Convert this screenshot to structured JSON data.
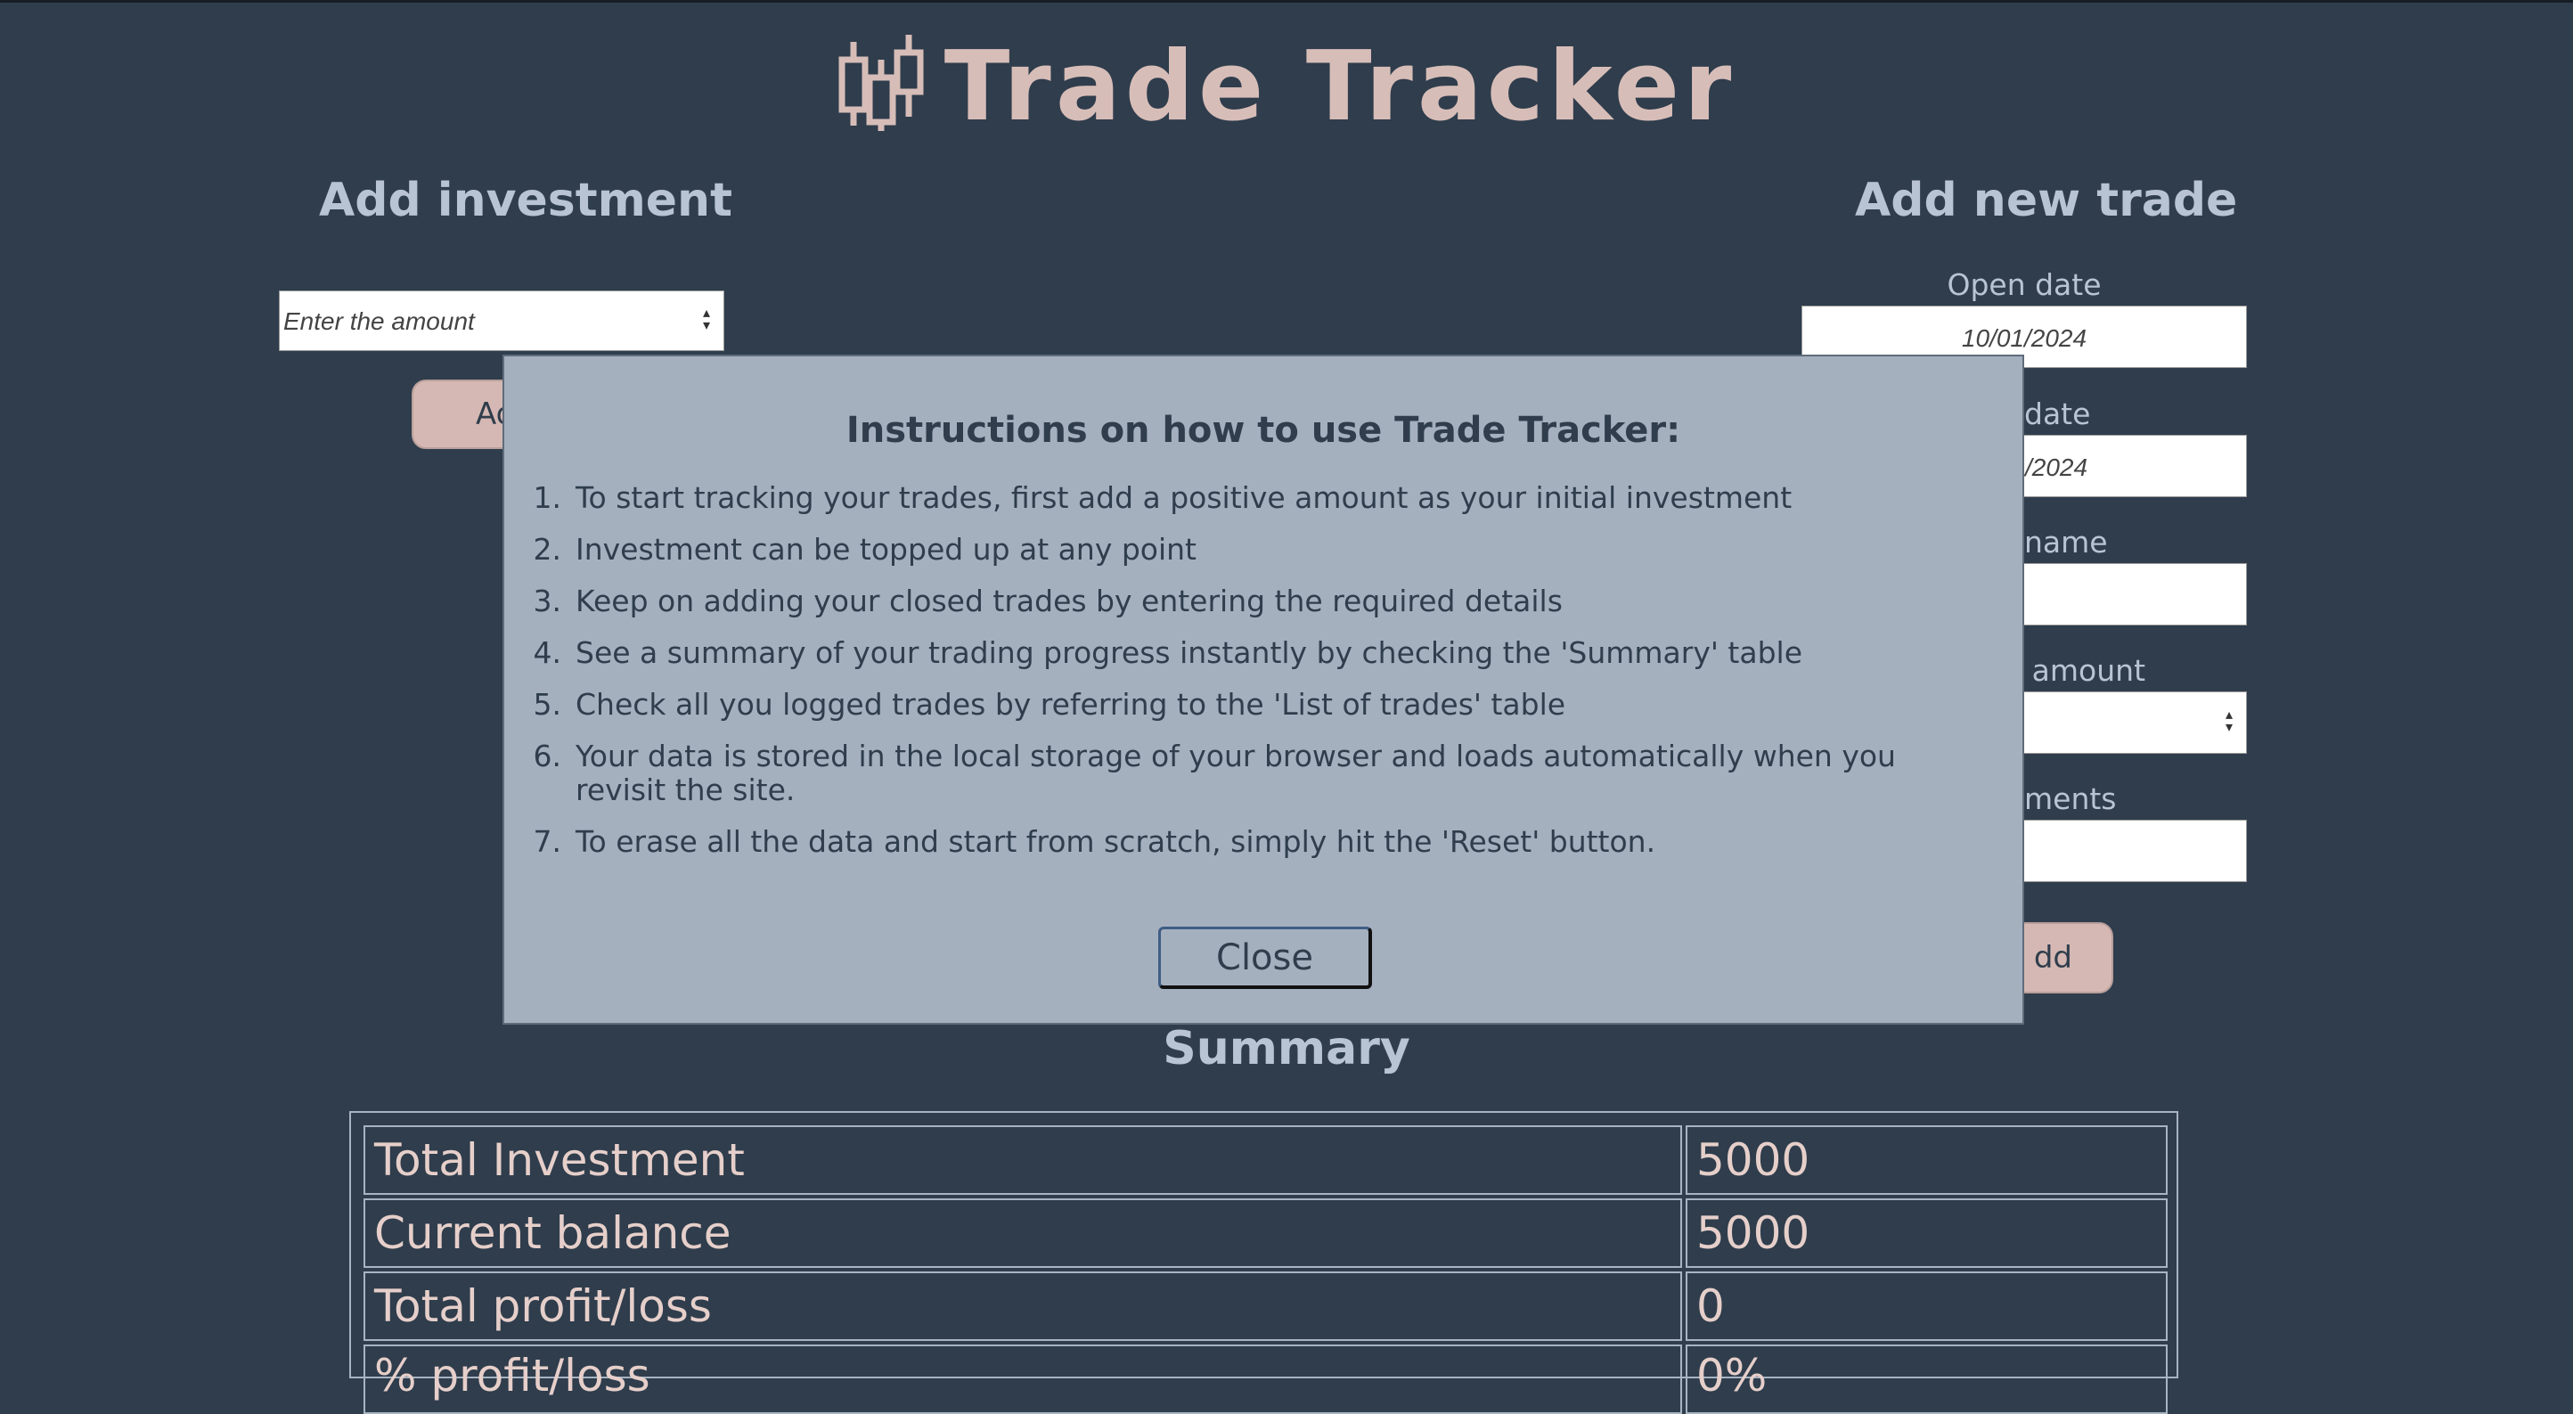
{
  "app": {
    "title": "Trade Tracker",
    "logo_icon": "candlestick-chart-icon"
  },
  "add_investment": {
    "title": "Add investment",
    "amount_placeholder": "Enter the amount",
    "button_label": "Ad"
  },
  "add_trade": {
    "title": "Add new trade",
    "open_date_label": "Open date",
    "open_date_value": "10/01/2024",
    "close_date_label": "date",
    "close_date_value": "/2024",
    "name_label": "name",
    "amount_label": "s amount",
    "comments_label": "ments",
    "button_label": "dd"
  },
  "summary": {
    "title": "Summary",
    "rows": [
      {
        "label": "Total Investment",
        "value": "5000"
      },
      {
        "label": "Current balance",
        "value": "5000"
      },
      {
        "label": "Total profit/loss",
        "value": "0"
      },
      {
        "label": "% profit/loss",
        "value": "0%"
      }
    ]
  },
  "modal": {
    "title": "Instructions on how to use Trade Tracker:",
    "items": [
      {
        "num": "1.",
        "text": "To start tracking your trades, first add a positive amount as your initial investment"
      },
      {
        "num": "2.",
        "text": "Investment can be topped up at any point"
      },
      {
        "num": "3.",
        "text": "Keep on adding your closed trades by entering the required details"
      },
      {
        "num": "4.",
        "text": "See a summary of your trading progress instantly by checking the 'Summary' table"
      },
      {
        "num": "5.",
        "text": "Check all you logged trades by referring to the 'List of trades' table"
      },
      {
        "num": "6.",
        "text": "Your data is stored in the local storage of your browser and loads automatically when you revisit the site."
      },
      {
        "num": "7.",
        "text": "To erase all the data and start from scratch, simply hit the 'Reset' button."
      }
    ],
    "close_label": "Close"
  },
  "colors": {
    "background": "#2f3d4c",
    "accent_pink": "#d7bdb8",
    "heading_blue": "#b8c4d3",
    "modal_bg": "#a5b0bf"
  }
}
